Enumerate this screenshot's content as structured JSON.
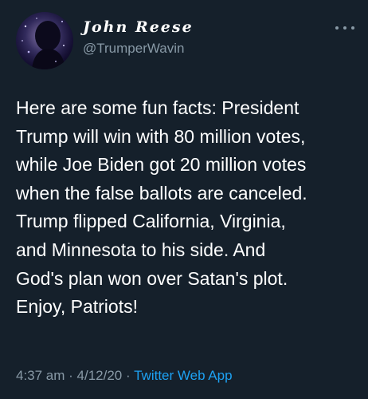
{
  "tweet": {
    "display_name": "John Reese",
    "handle": "@TrumperWavin",
    "more_icon": "ellipsis-icon",
    "text": "Here are some fun facts: President\nTrump will win with 80 million votes,\nwhile Joe Biden got 20 million votes\nwhen the false ballots are canceled.\nTrump flipped California, Virginia,\nand Minnesota to his side. And\nGod's plan won over Satan's plot.\nEnjoy, Patriots!",
    "time": "4:37 am",
    "separator_1": " · ",
    "date": "4/12/20",
    "separator_2": " · ",
    "source": "Twitter Web App"
  },
  "colors": {
    "background": "#15202b",
    "text_primary": "#ffffff",
    "text_secondary": "#8899a6",
    "link": "#1da1f2"
  }
}
